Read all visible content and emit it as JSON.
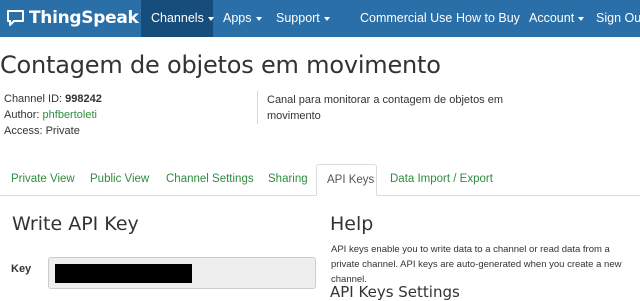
{
  "navbar": {
    "brand": "ThingSpeak",
    "brand_tm": "™",
    "items": [
      {
        "label": "Channels",
        "dropdown": true,
        "active": true
      },
      {
        "label": "Apps",
        "dropdown": true
      },
      {
        "label": "Support",
        "dropdown": true
      },
      {
        "label": "Commercial Use"
      },
      {
        "label": "How to Buy"
      },
      {
        "label": "Account",
        "dropdown": true
      },
      {
        "label": "Sign Out"
      }
    ]
  },
  "channel": {
    "title": "Contagem de objetos em movimento",
    "id_label": "Channel ID:",
    "id_value": "998242",
    "author_label": "Author:",
    "author_value": "phfbertoleti",
    "access_label": "Access:",
    "access_value": "Private",
    "description": "Canal para monitorar a contagem de objetos em movimento"
  },
  "tabs": [
    {
      "label": "Private View"
    },
    {
      "label": "Public View"
    },
    {
      "label": "Channel Settings"
    },
    {
      "label": "Sharing"
    },
    {
      "label": "API Keys",
      "active": true
    },
    {
      "label": "Data Import / Export"
    }
  ],
  "write_key": {
    "title": "Write API Key",
    "key_label": "Key"
  },
  "help": {
    "title": "Help",
    "text": "API keys enable you to write data to a channel or read data from a private channel. API keys are auto-generated when you create a new channel.",
    "settings_title": "API Keys Settings"
  },
  "colors": {
    "navbar": "#2a6fa7",
    "navbar_active": "#164d7b",
    "link": "#2f8d3f"
  }
}
